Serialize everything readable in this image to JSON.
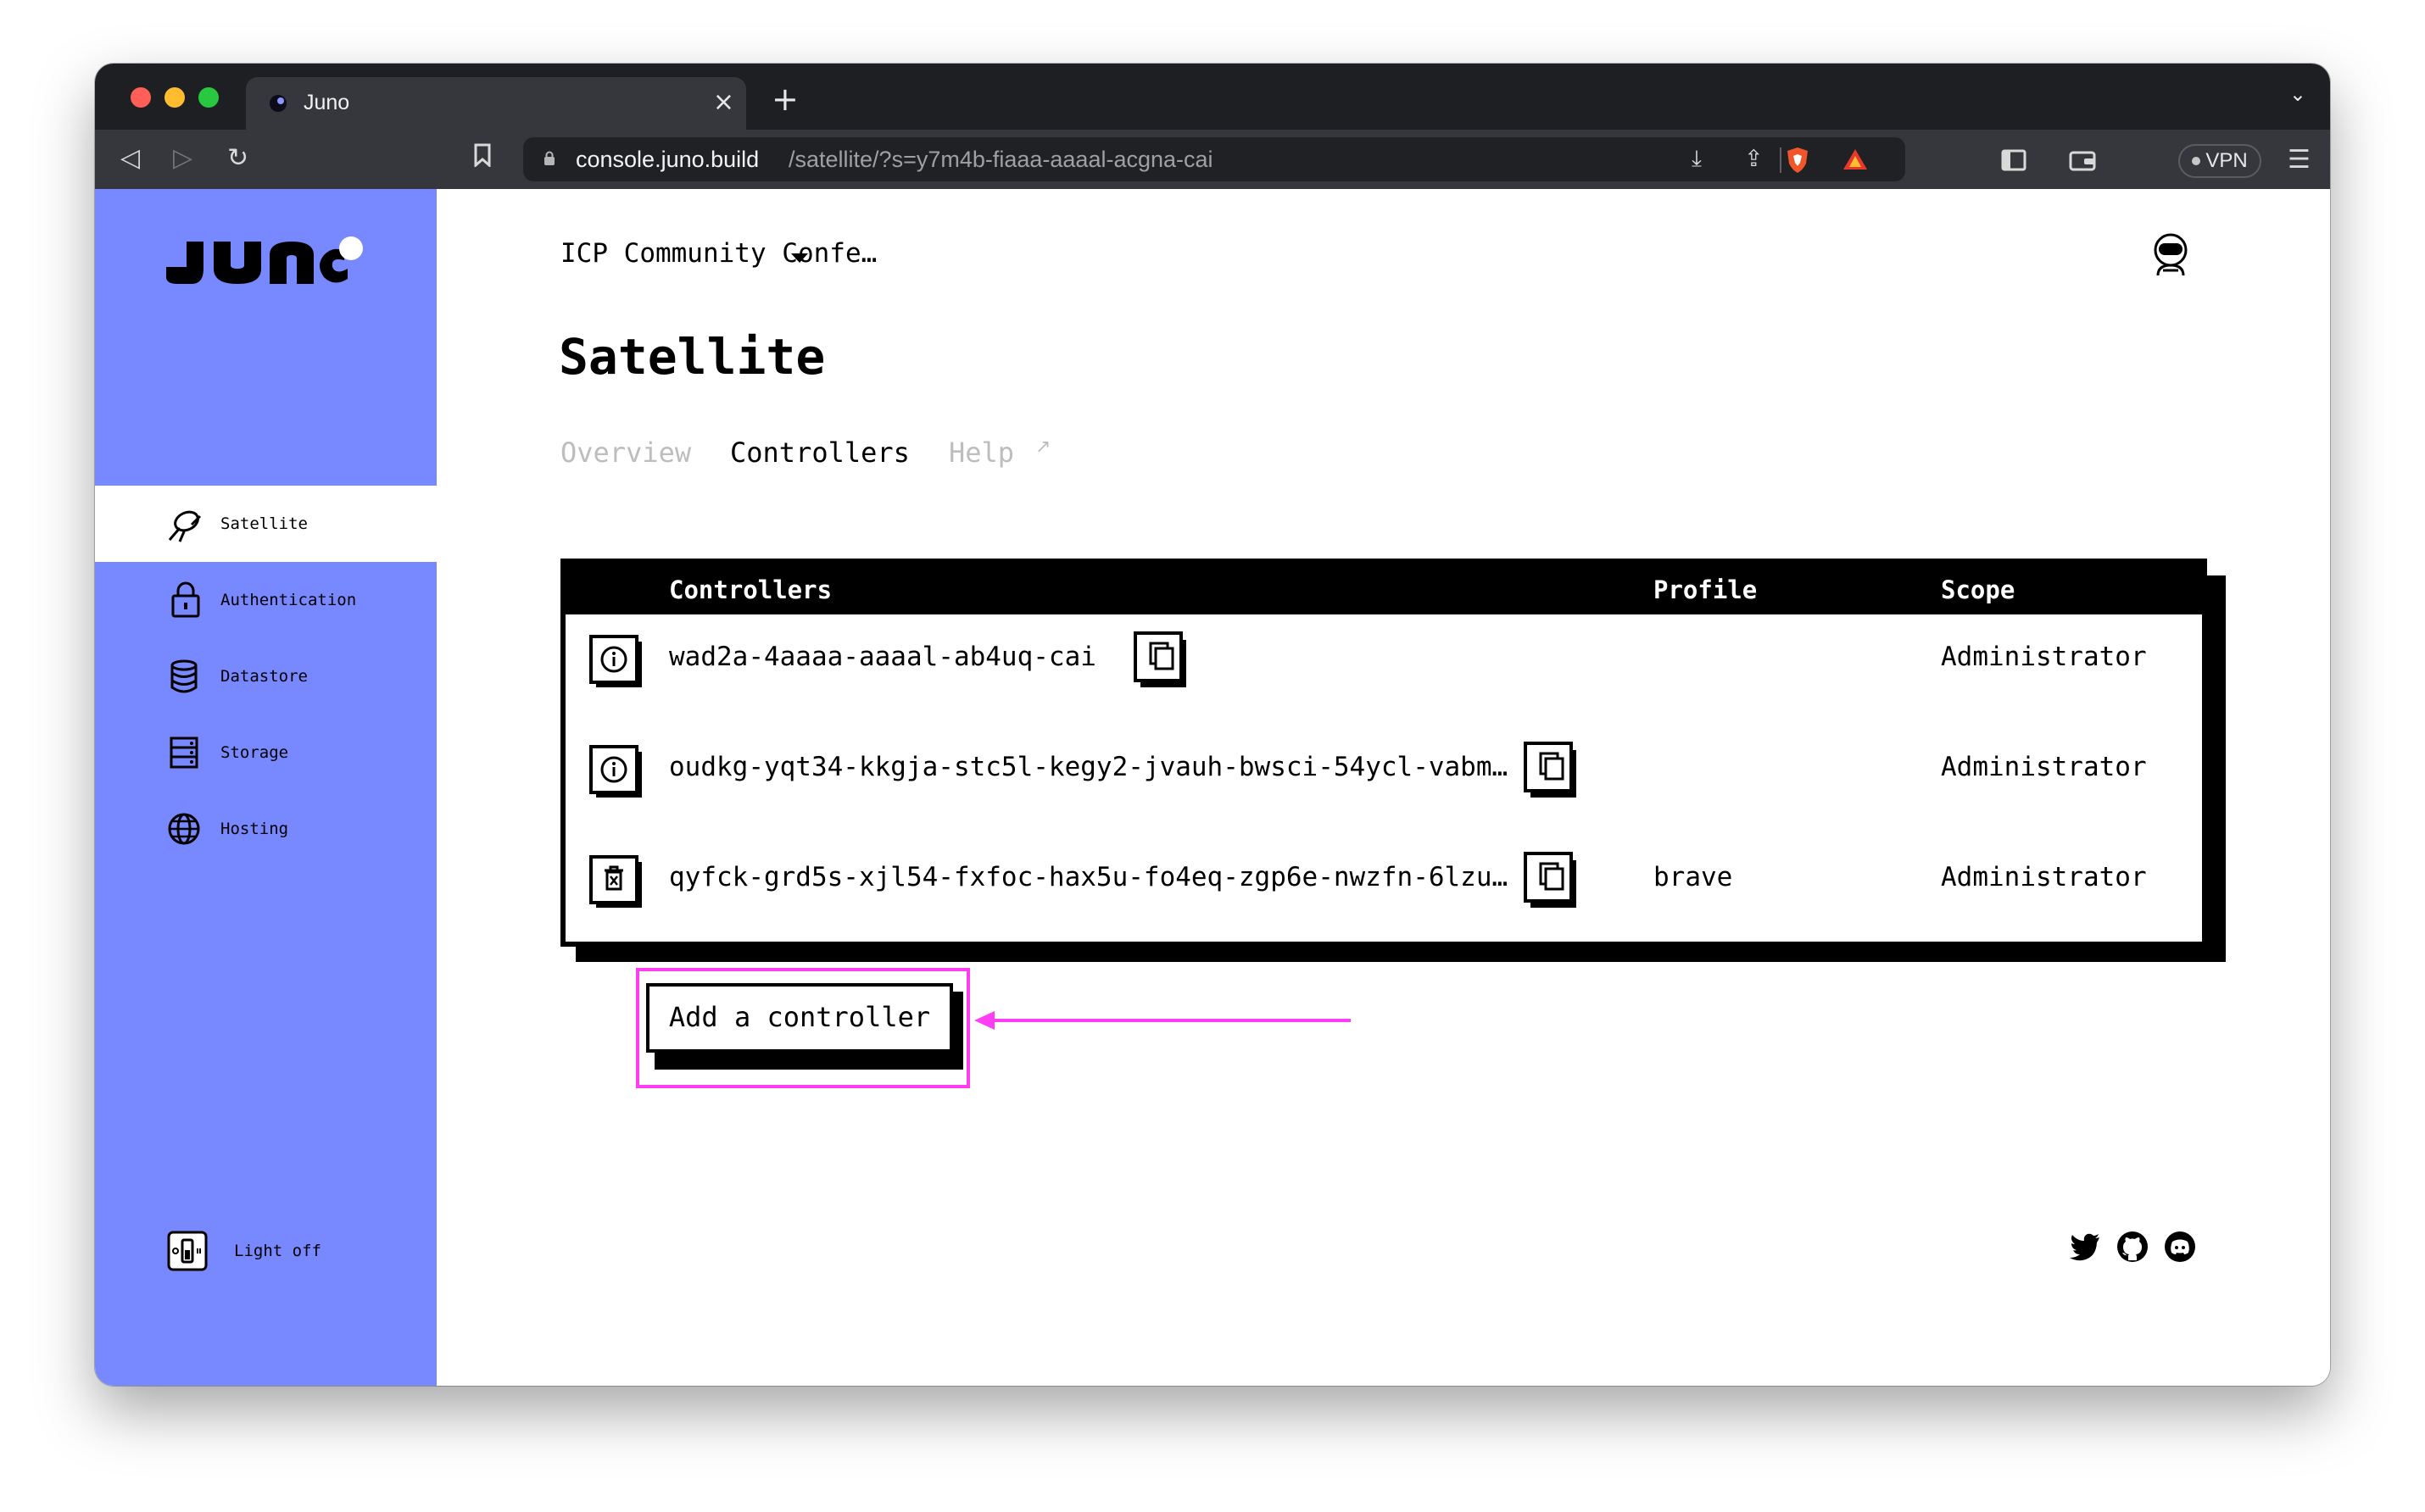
{
  "browser": {
    "tab_title": "Juno",
    "tab_close": "×",
    "new_tab": "+",
    "url_host": "console.juno.build",
    "url_path": "/satellite/?s=y7m4b-fiaaa-aaaal-acgna-cai",
    "vpn_label": "VPN"
  },
  "sidebar": {
    "items": [
      {
        "label": "Satellite",
        "icon": "satellite-icon"
      },
      {
        "label": "Authentication",
        "icon": "lock-icon"
      },
      {
        "label": "Datastore",
        "icon": "database-icon"
      },
      {
        "label": "Storage",
        "icon": "storage-icon"
      },
      {
        "label": "Hosting",
        "icon": "globe-icon"
      }
    ],
    "active": "Satellite",
    "theme_toggle_label": "Light off",
    "bg_color": "#7888ff"
  },
  "header": {
    "satellite_name": "ICP Community Confe…",
    "title": "Satellite"
  },
  "tabs": [
    {
      "label": "Overview",
      "active": false
    },
    {
      "label": "Controllers",
      "active": true
    },
    {
      "label": "Help",
      "active": false,
      "external": true
    }
  ],
  "controllers_table": {
    "headers": [
      "Controllers",
      "Profile",
      "Scope"
    ],
    "rows": [
      {
        "action_icon": "info-icon",
        "controller": "wad2a-4aaaa-aaaal-ab4uq-cai",
        "profile": "",
        "scope": "Administrator"
      },
      {
        "action_icon": "info-icon",
        "controller": "oudkg-yqt34-kkgja-stc5l-kegy2-jvauh-bwsci-54ycl-vabm…",
        "profile": "",
        "scope": "Administrator"
      },
      {
        "action_icon": "delete-icon",
        "controller": "qyfck-grd5s-xjl54-fxfoc-hax5u-fo4eq-zgp6e-nwzfn-6lzu…",
        "profile": "brave",
        "scope": "Administrator"
      }
    ]
  },
  "add_controller_label": "Add a controller",
  "annotation_color": "#ff3df2"
}
